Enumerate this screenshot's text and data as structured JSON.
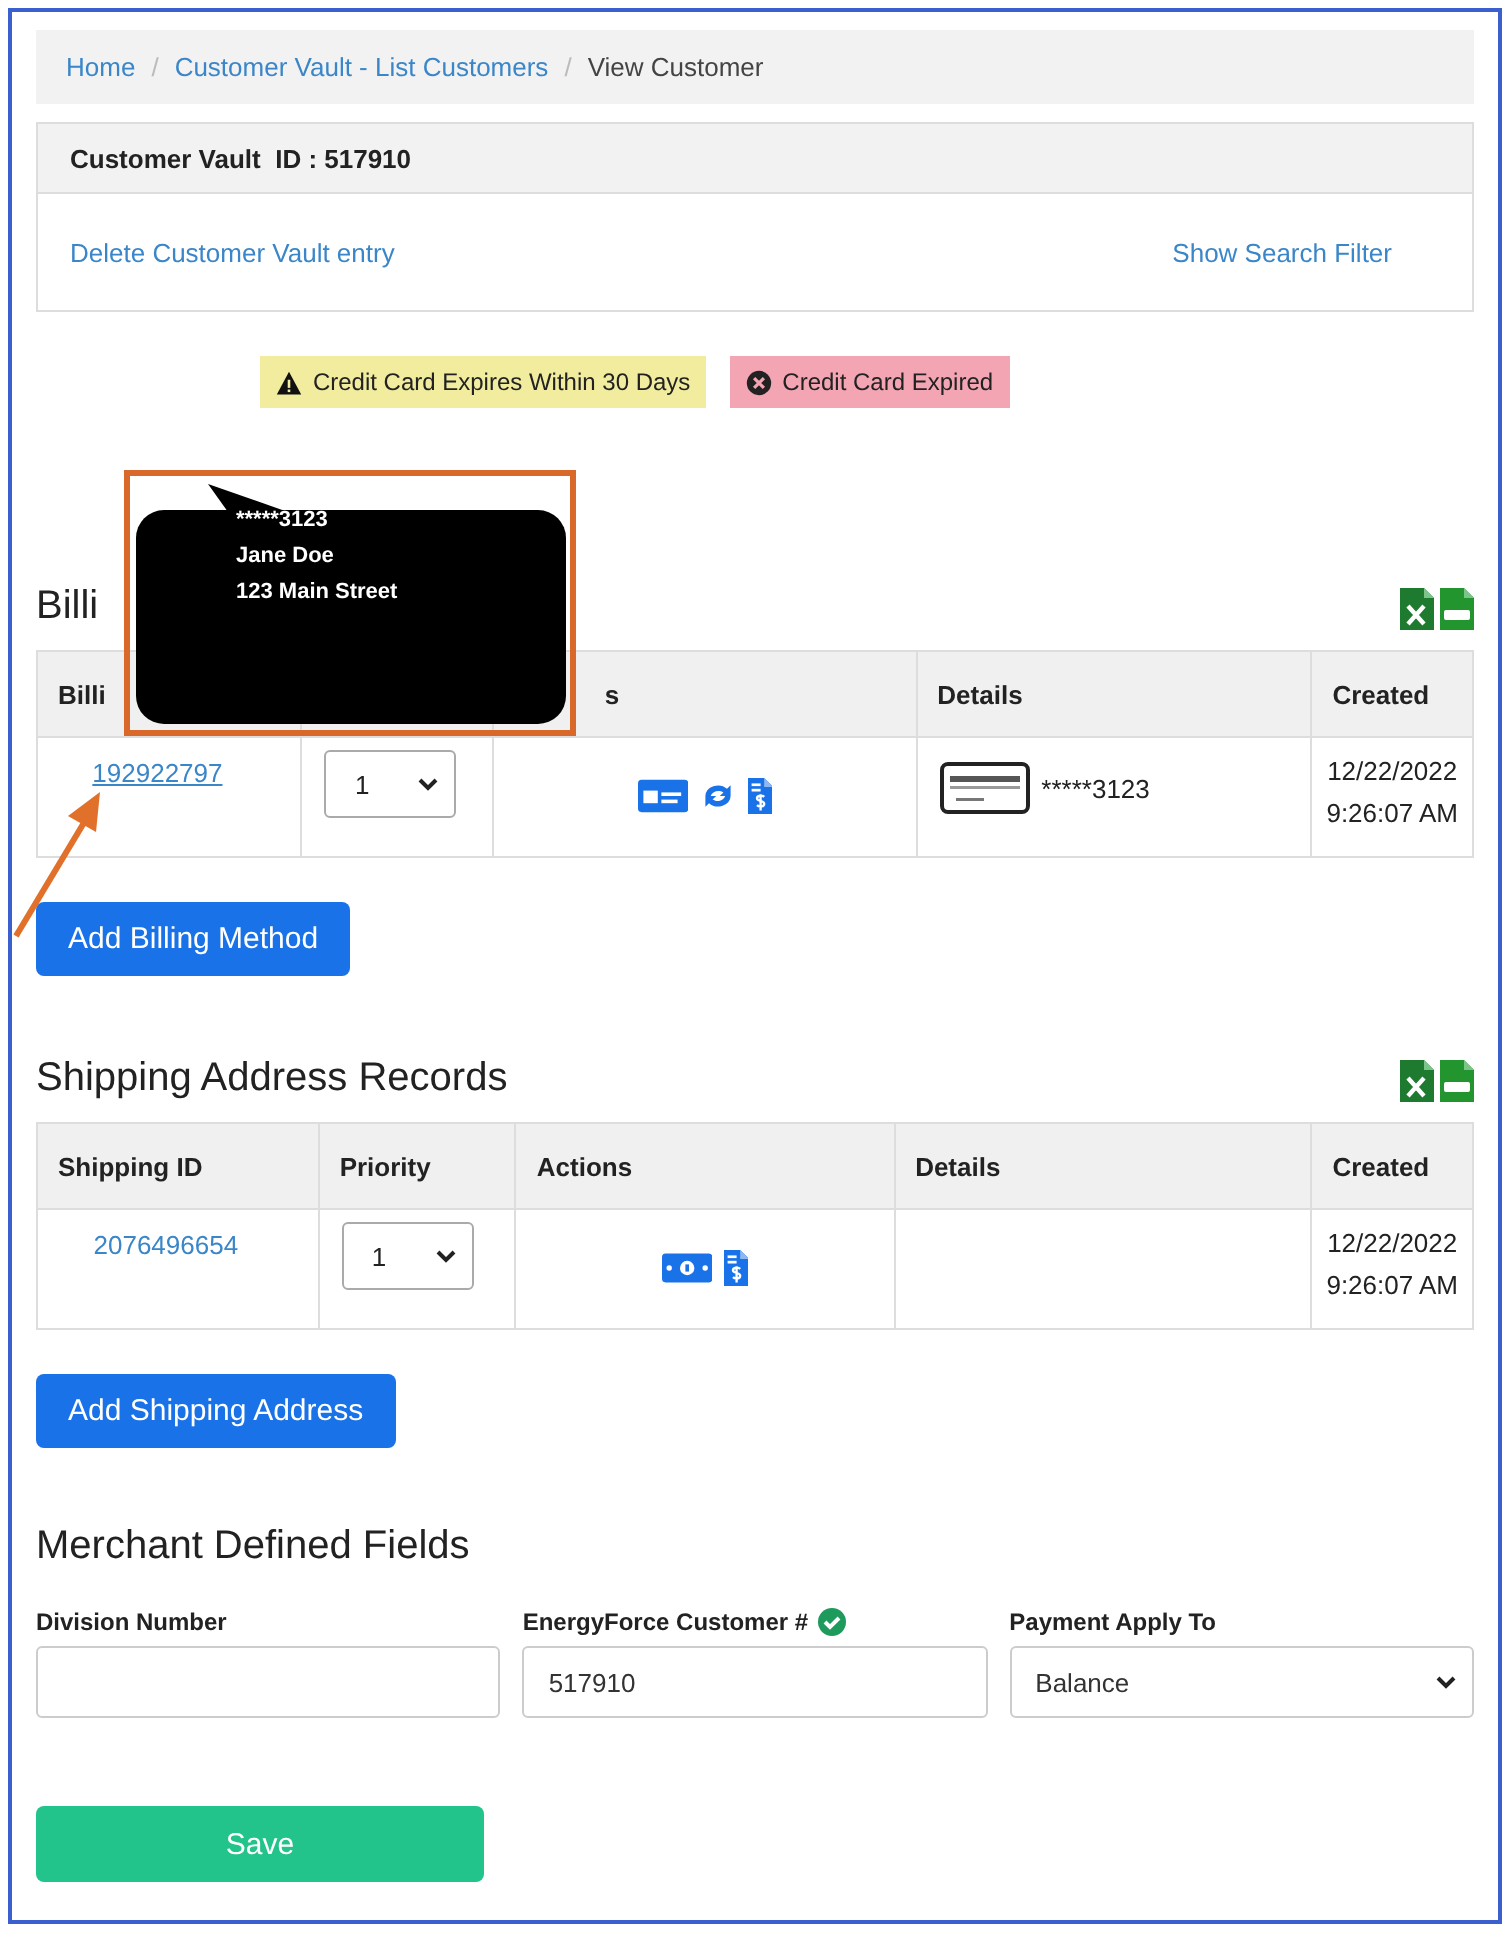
{
  "breadcrumb": [
    {
      "label": "Home",
      "link": true
    },
    {
      "separator": "/"
    },
    {
      "label": "Customer Vault - List Customers",
      "link": true
    },
    {
      "separator": "/"
    },
    {
      "label": "View Customer",
      "link": false
    }
  ],
  "vault": {
    "title": "Customer Vault  ID : 517910",
    "delete_link": "Delete Customer Vault entry",
    "filter_link": "Show Search Filter"
  },
  "badges": [
    {
      "kind": "warning",
      "label": "Credit Card Expires Within 30 Days"
    },
    {
      "kind": "expired",
      "label": "Credit Card Expired"
    }
  ],
  "billing": {
    "title": "Billi",
    "columns": [
      {
        "label": "Billi"
      },
      {},
      {
        "label": "s"
      },
      {
        "label": "Details"
      },
      {
        "label": "Created"
      }
    ],
    "rows": [
      {
        "id": "192922797",
        "priority": "1",
        "actions": [
          {
            "kind": "card"
          },
          {
            "kind": "sync"
          },
          {
            "kind": "invoice"
          }
        ],
        "details": "*****3123",
        "created": [
          "12/22/2022",
          "9:26:07 AM"
        ]
      }
    ],
    "add_button": "Add Billing Method"
  },
  "tooltip": {
    "lines": [
      "*****3123",
      "Jane Doe",
      "123 Main Street"
    ]
  },
  "shipping": {
    "title": "Shipping Address Records",
    "columns": [
      {
        "label": "Shipping ID"
      },
      {
        "label": "Priority"
      },
      {
        "label": "Actions"
      },
      {
        "label": "Details"
      },
      {
        "label": "Created"
      }
    ],
    "rows": [
      {
        "id": "2076496654",
        "priority": "1",
        "actions": [
          {
            "kind": "money"
          },
          {
            "kind": "invoice"
          }
        ],
        "created": [
          "12/22/2022",
          "9:26:07 AM"
        ]
      }
    ],
    "add_button": "Add Shipping Address"
  },
  "merchant": {
    "title": "Merchant Defined Fields",
    "fields": [
      {
        "kind": "text",
        "label": "Division Number",
        "verified": false
      },
      {
        "kind": "text",
        "label": "EnergyForce Customer #",
        "value": "517910",
        "verified": true
      },
      {
        "kind": "select",
        "label": "Payment Apply To",
        "value": "Balance",
        "verified": false
      }
    ]
  },
  "save_button": "Save"
}
